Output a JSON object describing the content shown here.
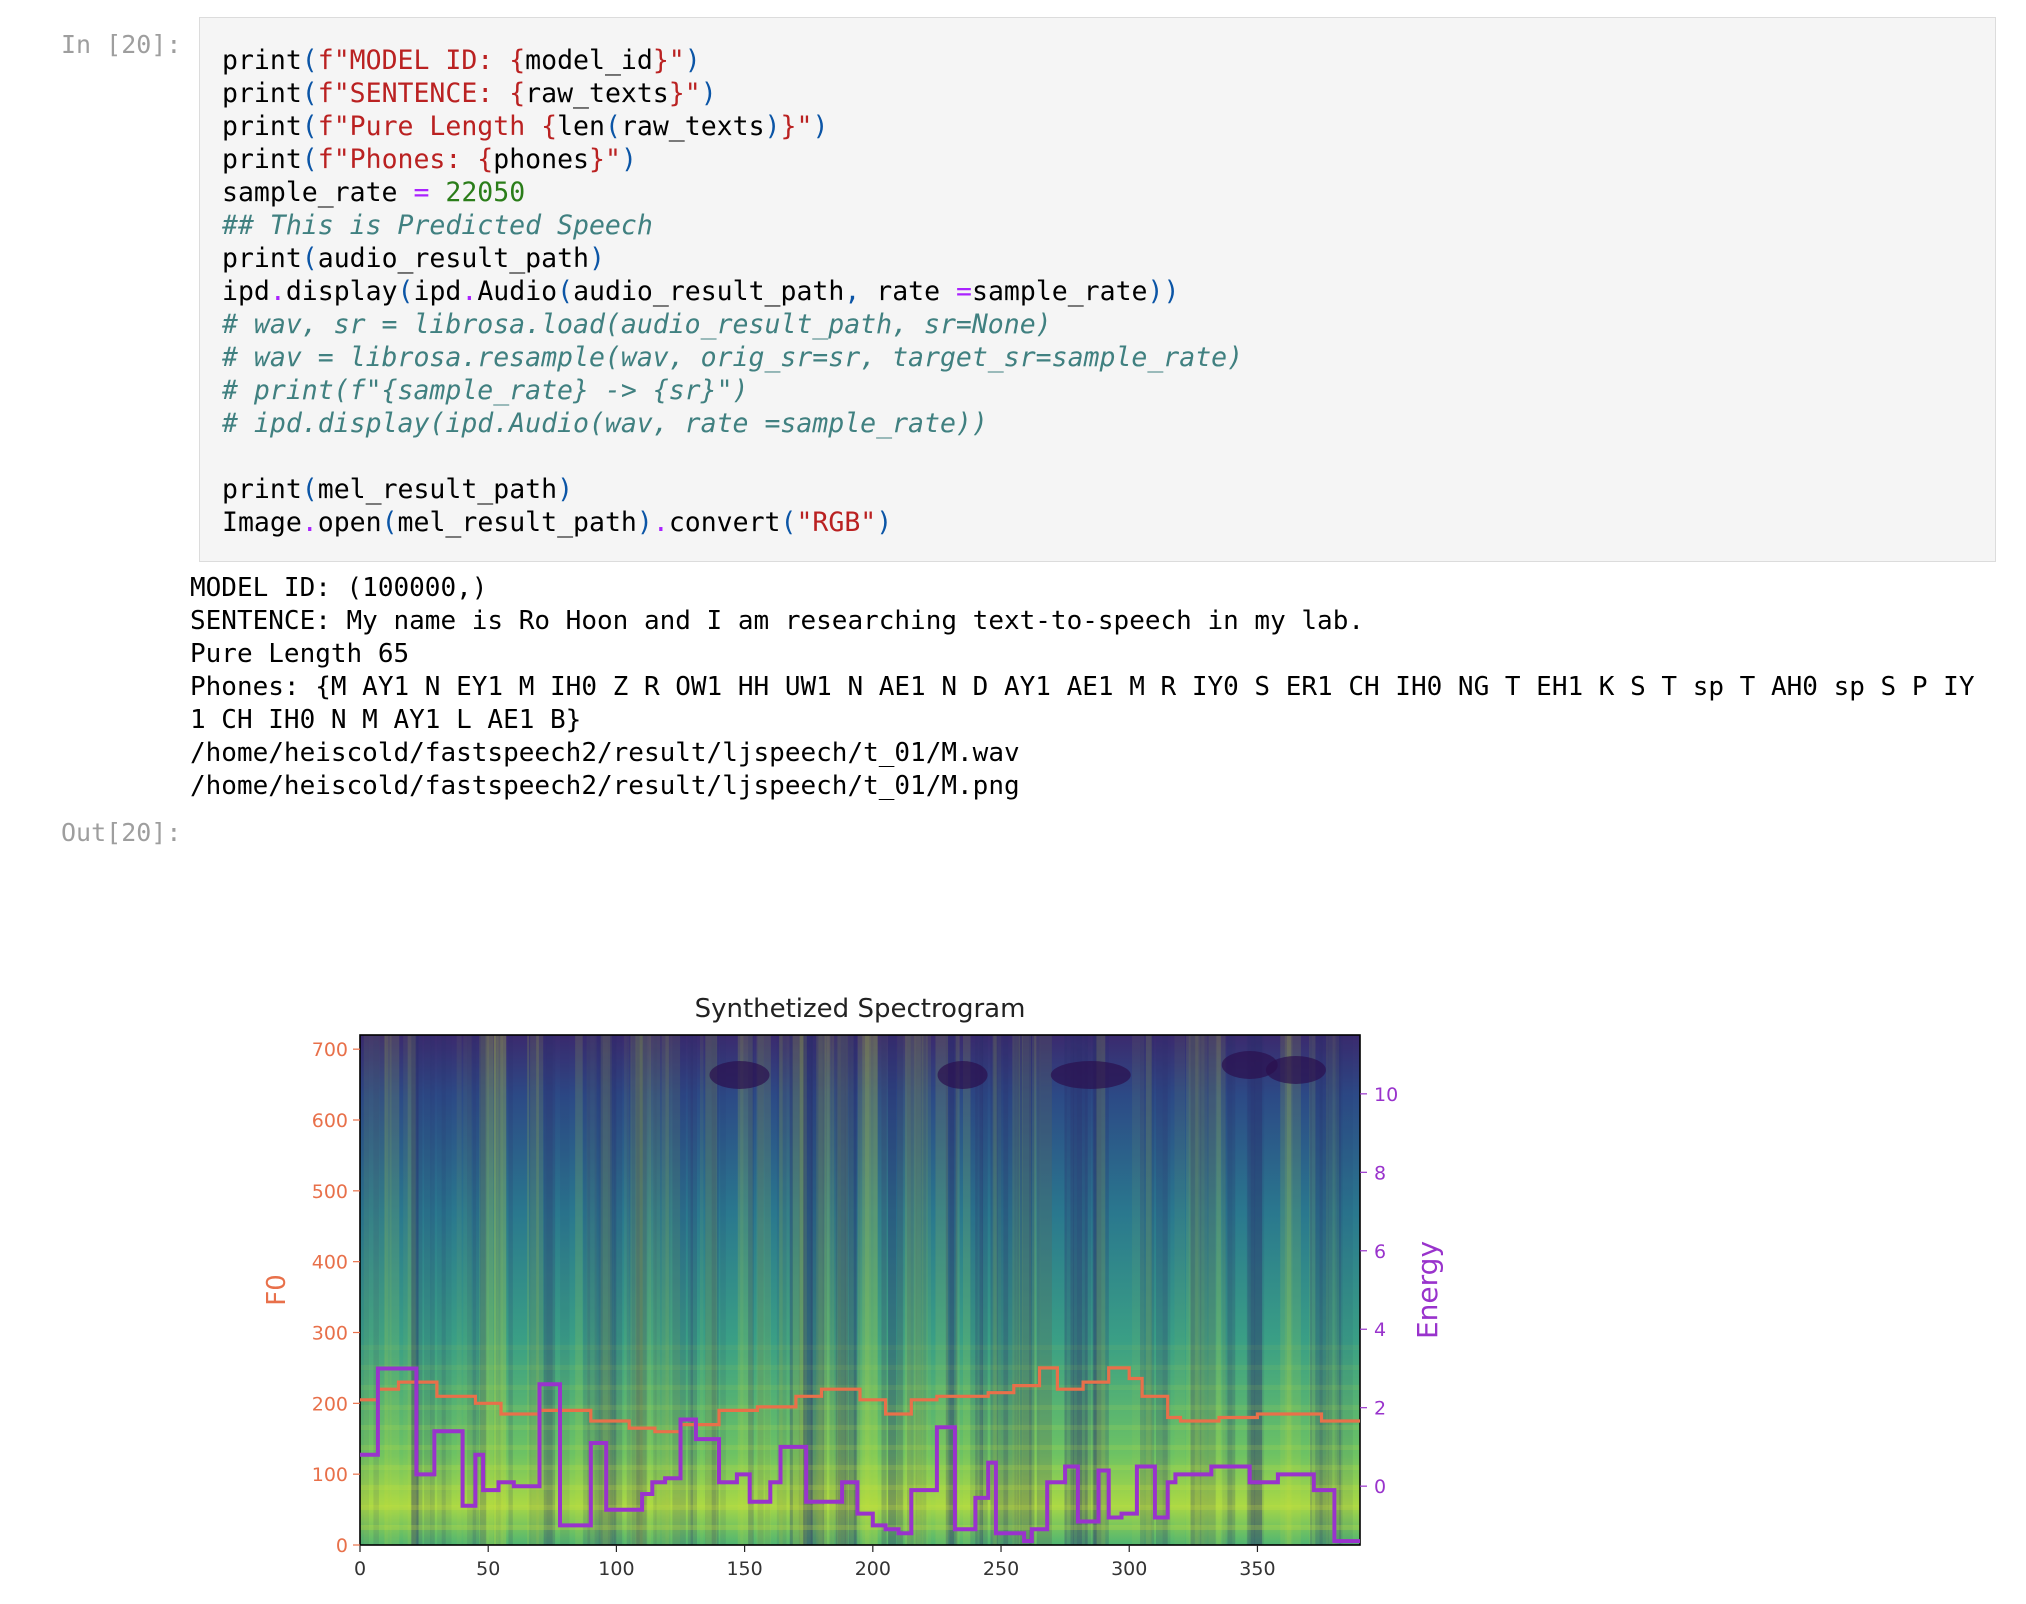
{
  "input_prompt": "In [20]:",
  "output_prompt": "Out[20]:",
  "code_lines": [
    [
      {
        "t": "print",
        "c": "k-fn"
      },
      {
        "t": "(",
        "c": "k-paren"
      },
      {
        "t": "f\"MODEL ID: ",
        "c": "k-str"
      },
      {
        "t": "{",
        "c": "k-str"
      },
      {
        "t": "model_id",
        "c": "k-fn"
      },
      {
        "t": "}",
        "c": "k-str"
      },
      {
        "t": "\"",
        "c": "k-str"
      },
      {
        "t": ")",
        "c": "k-paren"
      }
    ],
    [
      {
        "t": "print",
        "c": "k-fn"
      },
      {
        "t": "(",
        "c": "k-paren"
      },
      {
        "t": "f\"SENTENCE: ",
        "c": "k-str"
      },
      {
        "t": "{",
        "c": "k-str"
      },
      {
        "t": "raw_texts",
        "c": "k-fn"
      },
      {
        "t": "}",
        "c": "k-str"
      },
      {
        "t": "\"",
        "c": "k-str"
      },
      {
        "t": ")",
        "c": "k-paren"
      }
    ],
    [
      {
        "t": "print",
        "c": "k-fn"
      },
      {
        "t": "(",
        "c": "k-paren"
      },
      {
        "t": "f\"Pure Length ",
        "c": "k-str"
      },
      {
        "t": "{",
        "c": "k-str"
      },
      {
        "t": "len",
        "c": "k-fn"
      },
      {
        "t": "(",
        "c": "k-paren"
      },
      {
        "t": "raw_texts",
        "c": "k-fn"
      },
      {
        "t": ")",
        "c": "k-paren"
      },
      {
        "t": "}",
        "c": "k-str"
      },
      {
        "t": "\"",
        "c": "k-str"
      },
      {
        "t": ")",
        "c": "k-paren"
      }
    ],
    [
      {
        "t": "print",
        "c": "k-fn"
      },
      {
        "t": "(",
        "c": "k-paren"
      },
      {
        "t": "f\"Phones: ",
        "c": "k-str"
      },
      {
        "t": "{",
        "c": "k-str"
      },
      {
        "t": "phones",
        "c": "k-fn"
      },
      {
        "t": "}",
        "c": "k-str"
      },
      {
        "t": "\"",
        "c": "k-str"
      },
      {
        "t": ")",
        "c": "k-paren"
      }
    ],
    [
      {
        "t": "sample_rate ",
        "c": "k-fn"
      },
      {
        "t": "=",
        "c": "k-op"
      },
      {
        "t": " ",
        "c": "k-fn"
      },
      {
        "t": "22050",
        "c": "k-num"
      }
    ],
    [
      {
        "t": "## This is Predicted Speech",
        "c": "k-cm"
      }
    ],
    [
      {
        "t": "print",
        "c": "k-fn"
      },
      {
        "t": "(",
        "c": "k-paren"
      },
      {
        "t": "audio_result_path",
        "c": "k-fn"
      },
      {
        "t": ")",
        "c": "k-paren"
      }
    ],
    [
      {
        "t": "ipd",
        "c": "k-fn"
      },
      {
        "t": ".",
        "c": "k-dot"
      },
      {
        "t": "display",
        "c": "k-fn"
      },
      {
        "t": "(",
        "c": "k-paren"
      },
      {
        "t": "ipd",
        "c": "k-fn"
      },
      {
        "t": ".",
        "c": "k-dot"
      },
      {
        "t": "Audio",
        "c": "k-fn"
      },
      {
        "t": "(",
        "c": "k-paren"
      },
      {
        "t": "audio_result_path",
        "c": "k-fn"
      },
      {
        "t": ", ",
        "c": "k-paren"
      },
      {
        "t": "rate ",
        "c": "k-fn"
      },
      {
        "t": "=",
        "c": "k-op"
      },
      {
        "t": "sample_rate",
        "c": "k-fn"
      },
      {
        "t": "))",
        "c": "k-paren"
      }
    ],
    [
      {
        "t": "# wav, sr = librosa.load(audio_result_path, sr=None)",
        "c": "k-cm"
      }
    ],
    [
      {
        "t": "# wav = librosa.resample(wav, orig_sr=sr, target_sr=sample_rate)",
        "c": "k-cm"
      }
    ],
    [
      {
        "t": "# print(f\"{sample_rate} -> {sr}\")",
        "c": "k-cm"
      }
    ],
    [
      {
        "t": "# ipd.display(ipd.Audio(wav, rate =sample_rate))",
        "c": "k-cm"
      }
    ],
    [
      {
        "t": "",
        "c": "k-fn"
      }
    ],
    [
      {
        "t": "print",
        "c": "k-fn"
      },
      {
        "t": "(",
        "c": "k-paren"
      },
      {
        "t": "mel_result_path",
        "c": "k-fn"
      },
      {
        "t": ")",
        "c": "k-paren"
      }
    ],
    [
      {
        "t": "Image",
        "c": "k-fn"
      },
      {
        "t": ".",
        "c": "k-dot"
      },
      {
        "t": "open",
        "c": "k-fn"
      },
      {
        "t": "(",
        "c": "k-paren"
      },
      {
        "t": "mel_result_path",
        "c": "k-fn"
      },
      {
        "t": ")",
        "c": "k-paren"
      },
      {
        "t": ".",
        "c": "k-dot"
      },
      {
        "t": "convert",
        "c": "k-fn"
      },
      {
        "t": "(",
        "c": "k-paren"
      },
      {
        "t": "\"RGB\"",
        "c": "k-str"
      },
      {
        "t": ")",
        "c": "k-paren"
      }
    ]
  ],
  "output_lines": [
    "MODEL ID: (100000,)",
    "SENTENCE: My name is Ro Hoon and I am researching text-to-speech in my lab.",
    "Pure Length 65",
    "Phones: {M AY1 N EY1 M IH0 Z R OW1 HH UW1 N AE1 N D AY1 AE1 M R IY0 S ER1 CH IH0 NG T EH1 K S T sp T AH0 sp S P IY",
    "1 CH IH0 N M AY1 L AE1 B}",
    "/home/heiscold/fastspeech2/result/ljspeech/t_01/M.wav",
    "/home/heiscold/fastspeech2/result/ljspeech/t_01/M.png"
  ],
  "chart_data": {
    "type": "line",
    "title": "Synthetized Spectrogram",
    "background": "mel-spectrogram (viridis colormap)",
    "xlim": [
      0,
      390
    ],
    "x_ticks": [
      "0",
      "50",
      "100",
      "150",
      "200",
      "250",
      "300",
      "350"
    ],
    "ylabel_left": "F0",
    "ylim_left": [
      0,
      720
    ],
    "y_ticks_left": [
      "0",
      "100",
      "200",
      "300",
      "400",
      "500",
      "600",
      "700"
    ],
    "ylabel_right": "Energy",
    "ylim_right": [
      -1.5,
      11.5
    ],
    "y_ticks_right": [
      "0",
      "2",
      "4",
      "6",
      "8",
      "10"
    ],
    "colors": {
      "f0": "#e8704a",
      "energy": "#9933cc",
      "left_axis": "#e8704a",
      "right_axis": "#9933cc"
    },
    "series": [
      {
        "name": "F0",
        "axis": "left",
        "x": [
          0,
          7,
          7,
          15,
          15,
          30,
          30,
          45,
          45,
          55,
          55,
          70,
          70,
          90,
          90,
          105,
          105,
          115,
          115,
          125,
          125,
          140,
          140,
          155,
          155,
          170,
          170,
          180,
          180,
          195,
          195,
          205,
          205,
          215,
          215,
          225,
          225,
          245,
          245,
          255,
          255,
          265,
          265,
          272,
          272,
          282,
          282,
          292,
          292,
          300,
          300,
          305,
          305,
          315,
          315,
          320,
          320,
          335,
          335,
          350,
          350,
          375,
          375,
          390
        ],
        "y": [
          205,
          205,
          220,
          220,
          230,
          230,
          210,
          210,
          200,
          200,
          185,
          185,
          190,
          190,
          175,
          175,
          165,
          165,
          160,
          160,
          170,
          170,
          190,
          190,
          195,
          195,
          210,
          210,
          220,
          220,
          205,
          205,
          185,
          185,
          205,
          205,
          210,
          210,
          215,
          215,
          225,
          225,
          250,
          250,
          220,
          220,
          230,
          230,
          250,
          250,
          235,
          235,
          210,
          210,
          180,
          180,
          175,
          175,
          180,
          180,
          185,
          185,
          175,
          175
        ]
      },
      {
        "name": "Energy",
        "axis": "right",
        "x": [
          0,
          7,
          7,
          22,
          22,
          29,
          29,
          40,
          40,
          45,
          45,
          48,
          48,
          54,
          54,
          60,
          60,
          70,
          70,
          78,
          78,
          90,
          90,
          96,
          96,
          110,
          110,
          114,
          114,
          119,
          119,
          125,
          125,
          131,
          131,
          140,
          140,
          147,
          147,
          152,
          152,
          160,
          160,
          164,
          164,
          174,
          174,
          188,
          188,
          194,
          194,
          200,
          200,
          205,
          205,
          210,
          210,
          215,
          215,
          225,
          225,
          232,
          232,
          240,
          240,
          245,
          245,
          248,
          248,
          259,
          259,
          262,
          262,
          268,
          268,
          275,
          275,
          280,
          280,
          288,
          288,
          292,
          292,
          297,
          297,
          303,
          303,
          310,
          310,
          315,
          315,
          318,
          318,
          325,
          325,
          332,
          332,
          347,
          347,
          358,
          358,
          372,
          372,
          380,
          380,
          386,
          386,
          390
        ],
        "y": [
          0.8,
          0.8,
          3,
          3,
          0.3,
          0.3,
          1.4,
          1.4,
          -0.5,
          -0.5,
          0.8,
          0.8,
          -0.1,
          -0.1,
          0.1,
          0.1,
          0,
          0,
          2.6,
          2.6,
          -1,
          -1,
          1.1,
          1.1,
          -0.6,
          -0.6,
          -0.2,
          -0.2,
          0.1,
          0.1,
          0.2,
          0.2,
          1.7,
          1.7,
          1.2,
          1.2,
          0.1,
          0.1,
          0.3,
          0.3,
          -0.4,
          -0.4,
          0.1,
          0.1,
          1,
          1,
          -0.4,
          -0.4,
          0.1,
          0.1,
          -0.7,
          -0.7,
          -1,
          -1,
          -1.1,
          -1.1,
          -1.2,
          -1.2,
          -0.1,
          -0.1,
          1.5,
          1.5,
          -1.1,
          -1.1,
          -0.3,
          -0.3,
          0.6,
          0.6,
          -1.2,
          -1.2,
          -1.4,
          -1.4,
          -1.1,
          -1.1,
          0.1,
          0.1,
          0.5,
          0.5,
          -0.9,
          -0.9,
          0.4,
          0.4,
          -0.8,
          -0.8,
          -0.7,
          -0.7,
          0.5,
          0.5,
          -0.8,
          -0.8,
          0.1,
          0.1,
          0.3,
          0.3,
          0.3,
          0.3,
          0.5,
          0.5,
          0.1,
          0.1,
          0.3,
          0.3,
          -0.1,
          -0.1,
          -1.4,
          -1.4,
          -1.4,
          -1.4
        ]
      }
    ]
  }
}
